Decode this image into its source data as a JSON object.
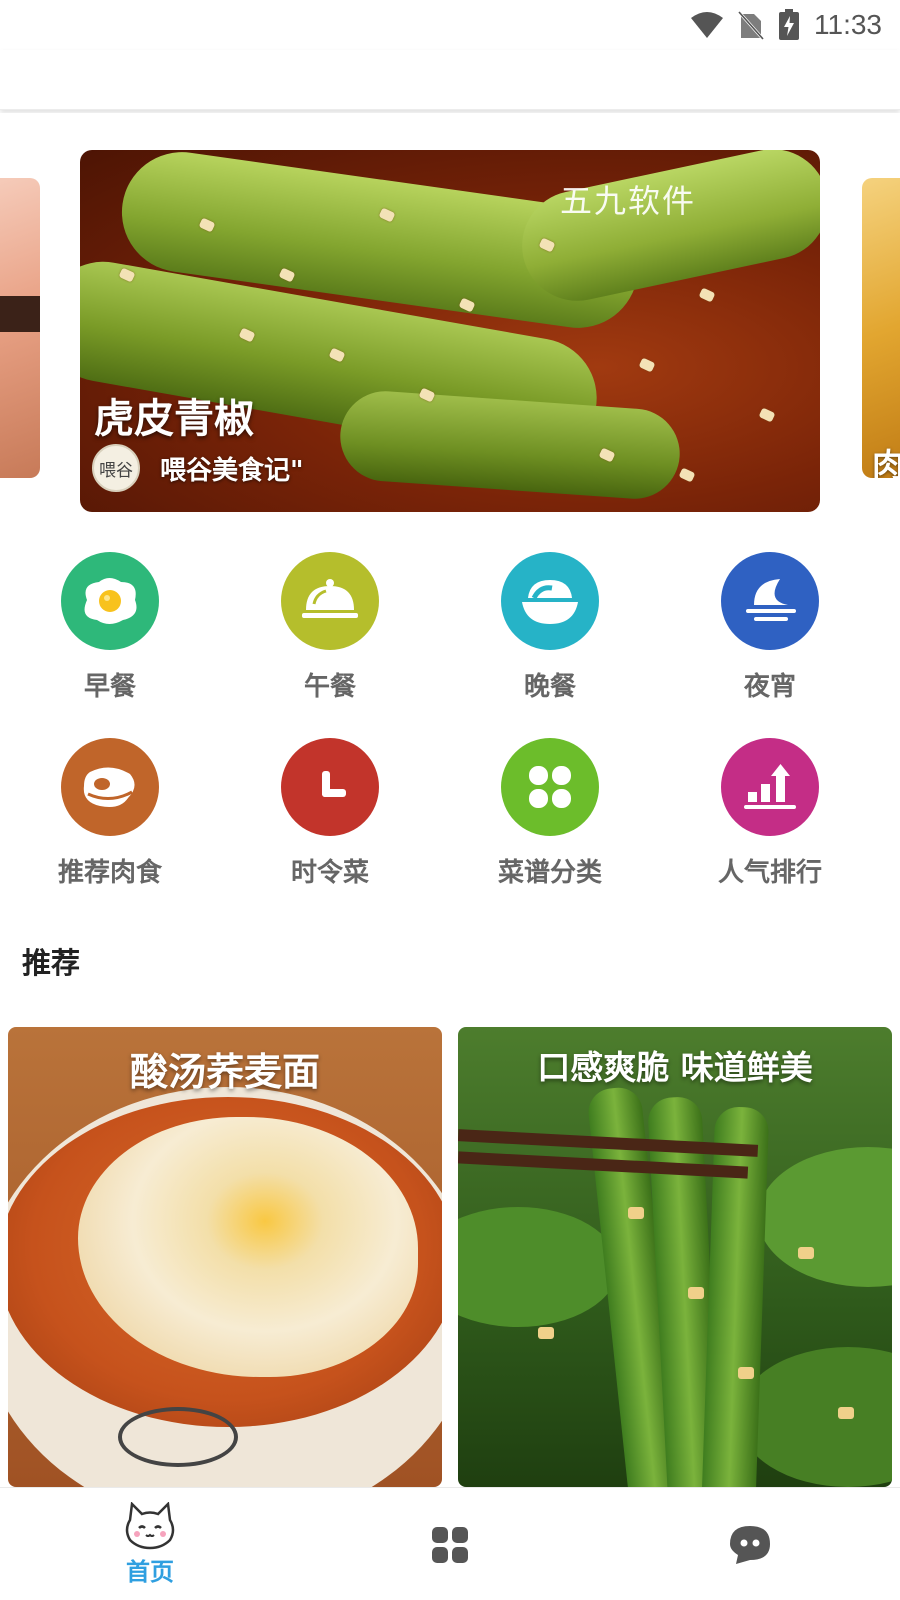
{
  "status_bar": {
    "time": "11:33",
    "icons": [
      "wifi-icon",
      "no-sim-icon",
      "battery-charging-icon"
    ]
  },
  "banner": {
    "title": "虎皮青椒",
    "author": "喂谷美食记\"",
    "avatar_text": "喂谷",
    "watermark": "五九软件",
    "next_title_partial": "肉"
  },
  "categories": [
    {
      "label": "早餐",
      "icon": "fried-egg-icon",
      "color": "#2eb87a"
    },
    {
      "label": "午餐",
      "icon": "cloche-icon",
      "color": "#b5be2c"
    },
    {
      "label": "晚餐",
      "icon": "bowl-icon",
      "color": "#26b3c7"
    },
    {
      "label": "夜宵",
      "icon": "moon-icon",
      "color": "#2f61c2"
    },
    {
      "label": "推荐肉食",
      "icon": "steak-icon",
      "color": "#c0652a"
    },
    {
      "label": "时令菜",
      "icon": "clock-icon",
      "color": "#c2342b"
    },
    {
      "label": "菜谱分类",
      "icon": "clover-icon",
      "color": "#6cbd2b"
    },
    {
      "label": "人气排行",
      "icon": "ranking-icon",
      "color": "#c42d86"
    }
  ],
  "recommend": {
    "title": "推荐",
    "cards": [
      {
        "title": "酸汤荞麦面"
      },
      {
        "title": "口感爽脆 味道鲜美"
      }
    ]
  },
  "bottom_nav": {
    "items": [
      {
        "label": "首页",
        "icon": "cat-home-icon",
        "active": true
      },
      {
        "label": "",
        "icon": "grid-icon",
        "active": false
      },
      {
        "label": "",
        "icon": "chat-icon",
        "active": false
      }
    ],
    "active_color": "#2f9fe0"
  }
}
